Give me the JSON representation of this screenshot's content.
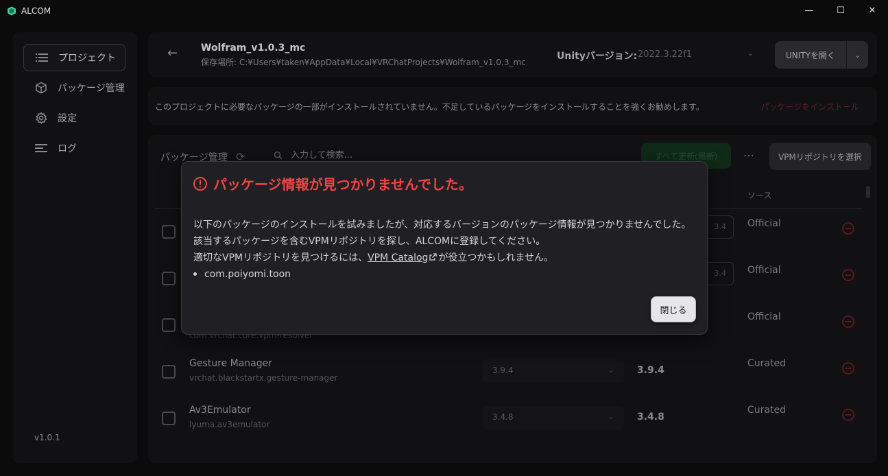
{
  "window": {
    "title": "ALCOM",
    "minimize_glyph": "—",
    "maximize_glyph": "☐",
    "close_glyph": "✕"
  },
  "sidebar": {
    "items": [
      {
        "label": "プロジェクト",
        "icon": "list-icon",
        "active": true
      },
      {
        "label": "パッケージ管理",
        "icon": "package-icon",
        "active": false
      },
      {
        "label": "設定",
        "icon": "gear-icon",
        "active": false
      },
      {
        "label": "ログ",
        "icon": "log-icon",
        "active": false
      }
    ],
    "version": "v1.0.1"
  },
  "header": {
    "project_name": "Wolfram_v1.0.3_mc",
    "path_label": "保存場所:",
    "path": "C:¥Users¥taken¥AppData¥Local¥VRChatProjects¥Wolfram_v1.0.3_mc",
    "unity_label": "Unityバージョン:",
    "unity_version": "2022.3.22f1",
    "open_unity_label": "UNITYを開く"
  },
  "warning": {
    "text": "このプロジェクトに必要なパッケージの一部がインストールされていません。不足しているパッケージをインストールすることを強くお勧めします。",
    "install_label": "パッケージをインストール"
  },
  "packages": {
    "title": "パッケージ管理",
    "search_placeholder": "入力して検索...",
    "update_all_label": "すべて更新(最新)",
    "vpm_select_label": "VPMリポジトリを選択",
    "source_header": "ソース",
    "rows": [
      {
        "name": "",
        "id": "",
        "installed": "",
        "latest": "",
        "mini": "3.4",
        "source": "Official"
      },
      {
        "name": "",
        "id": "",
        "installed": "",
        "latest": "",
        "mini": "3.4",
        "source": "Official"
      },
      {
        "name": "",
        "id": "com.vrchat.core.vpm-resolver",
        "installed": "",
        "latest": "",
        "mini": "",
        "source": "Official"
      },
      {
        "name": "Gesture Manager",
        "id": "vrchat.blackstartx.gesture-manager",
        "installed": "3.9.4",
        "latest": "3.9.4",
        "mini": "",
        "source": "Curated"
      },
      {
        "name": "Av3Emulator",
        "id": "lyuma.av3emulator",
        "installed": "3.4.8",
        "latest": "3.4.8",
        "mini": "",
        "source": "Curated"
      }
    ]
  },
  "dialog": {
    "title": "パッケージ情報が見つかりませんでした。",
    "line1": "以下のパッケージのインストールを試みましたが、対応するバージョンのパッケージ情報が見つかりませんでした。",
    "line2": "該当するパッケージを含むVPMリポジトリを探し、ALCOMに登録してください。",
    "line3_pre": "適切なVPMリポジトリを見つけるには、",
    "line3_link": "VPM Catalog",
    "line3_post": "が役立つかもしれません。",
    "missing_packages": [
      "com.poiyomi.toon"
    ],
    "close_label": "閉じる"
  },
  "colors": {
    "accent_error": "#f04444",
    "background": "#0b0b0c",
    "card": "#111113",
    "dialog": "#202024"
  }
}
